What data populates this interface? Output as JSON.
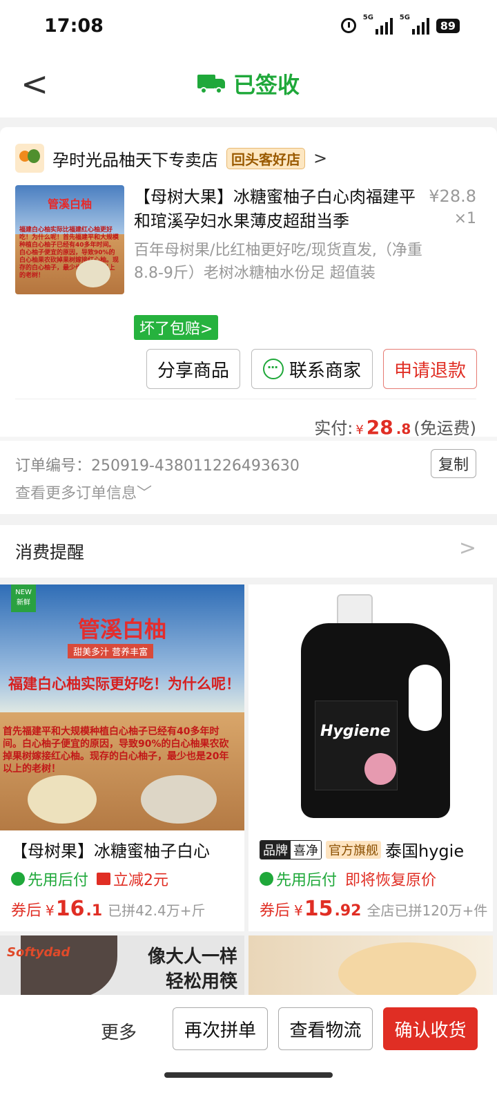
{
  "status_bar": {
    "time": "17:08",
    "sig1_label": "5G",
    "sig2_label": "5G",
    "battery": "89"
  },
  "nav": {
    "back_label": "<",
    "title": "已签收"
  },
  "shop": {
    "name": "孕时光品柚天下专卖店",
    "badge": "回头客好店",
    "chevron": ">"
  },
  "product": {
    "thumb_title": "管溪白柚",
    "thumb_text": "福建白心柚实际比福建红心柚更好吃！为什么呢！首先福建平和大规模种植白心柚子已经有40多年时间。白心柚子便宜的原因，导致90%的白心柚果农砍掉果树嫁接红心柚。现存的白心柚子，最少也是20年以上的老树！",
    "title": "【母树大果】冰糖蜜柚子白心肉福建平和琯溪孕妇水果薄皮超甜当季",
    "price": "¥28.8",
    "qty": "×1",
    "desc": "百年母树果/比红柚更好吃/现货直发,（净重8.8-9斤）老树冰糖柚水份足 超值装",
    "guarantee": "坏了包赔>"
  },
  "actions": {
    "share": "分享商品",
    "contact": "联系商家",
    "refund": "申请退款"
  },
  "payment": {
    "label": "实付:",
    "currency": "¥",
    "amount_int": "28",
    "amount_dec": ".8",
    "note": "(免运费)"
  },
  "order": {
    "number_label": "订单编号：250919-438011226493630",
    "copy": "复制",
    "more_info": "查看更多订单信息﹀"
  },
  "reminder": {
    "title": "消费提醒",
    "chevron": ">"
  },
  "recommend": [
    {
      "img_new": "NEW 新鲜",
      "img_title": "管溪白柚",
      "img_sub": "甜美多汁 营养丰富",
      "img_q": "福建白心柚实际更好吃！为什么呢！",
      "img_body": "首先福建平和大规模种植白心柚子已经有40多年时间。白心柚子便宜的原因，导致90%的白心柚果农砍掉果树嫁接红心柚。现存的白心柚子，最少也是20年以上的老树！",
      "name": "【母树果】冰糖蜜柚子白心",
      "tag1": "先用后付",
      "tag2": "立减2元",
      "price_prefix": "券后",
      "currency": "¥",
      "price_int": "16",
      "price_dec": ".1",
      "sold": "已拼42.4万+斤"
    },
    {
      "brand_tag_a": "品牌",
      "brand_tag_b": "喜净",
      "flag_tag": "官方旗舰",
      "name": "泰国hygie",
      "img_brand": "Hygiene",
      "tag1": "先用后付",
      "tag2": "即将恢复原价",
      "price_prefix": "券后",
      "currency": "¥",
      "price_int": "15",
      "price_dec": ".92",
      "sold": "全店已拼120万+件"
    }
  ],
  "recommend_row2": {
    "left_logo": "Softydad",
    "left_slogan1": "像大人一样",
    "left_slogan2": "轻松用筷"
  },
  "bottom": {
    "more": "更多",
    "again": "再次拼单",
    "track": "查看物流",
    "confirm": "确认收货"
  },
  "colors": {
    "accent_green": "#1fa83a",
    "accent_red": "#e02e24"
  }
}
